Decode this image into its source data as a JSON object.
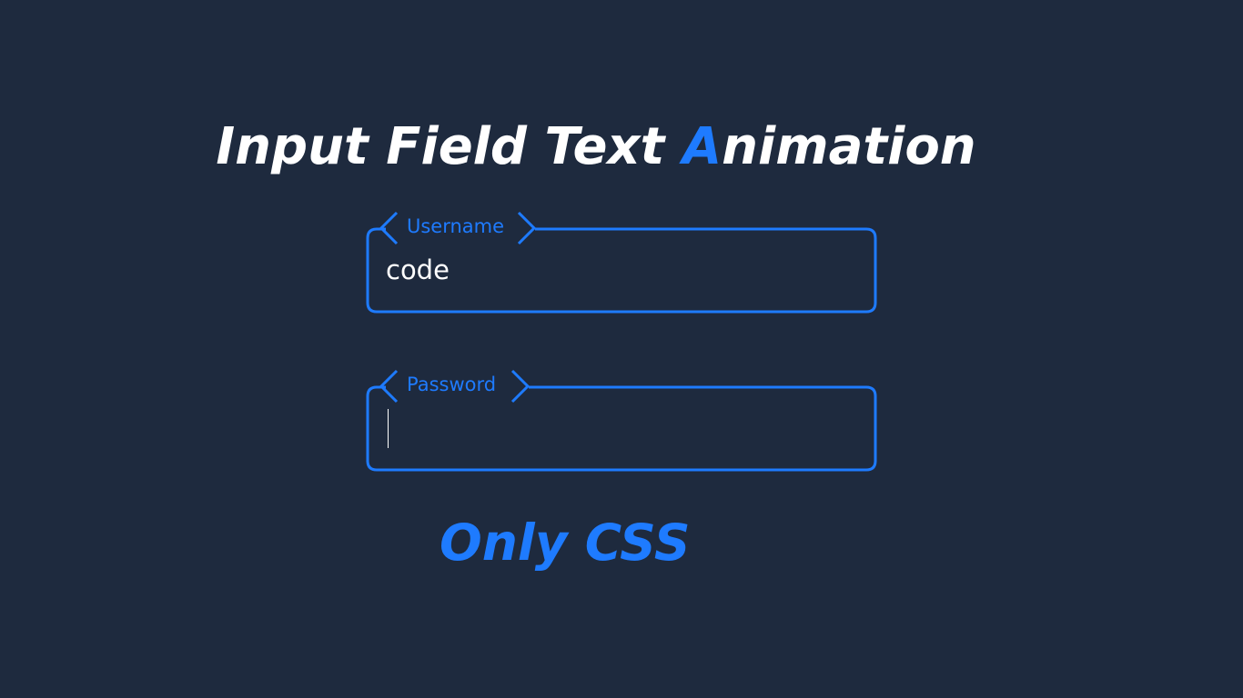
{
  "title": {
    "before_accent": "Input Field Text ",
    "accent": "A",
    "after_accent": "nimation"
  },
  "form": {
    "username": {
      "label": "Username",
      "value": "code"
    },
    "password": {
      "label": "Password",
      "value": ""
    }
  },
  "subtitle": "Only CSS",
  "colors": {
    "background": "#1e2a3e",
    "accent": "#1e7bff",
    "text": "#ffffff"
  }
}
